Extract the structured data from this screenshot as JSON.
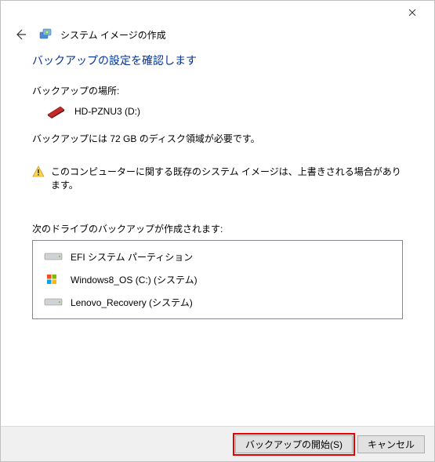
{
  "window": {
    "title": "システム イメージの作成"
  },
  "page": {
    "heading": "バックアップの設定を確認します",
    "location_label": "バックアップの場所:",
    "location_name": "HD-PZNU3 (D:)",
    "disk_requirement": "バックアップには 72 GB のディスク領域が必要です。",
    "warning": "このコンピューターに関する既存のシステム イメージは、上書きされる場合があります。",
    "drives_label": "次のドライブのバックアップが作成されます:"
  },
  "drives": [
    {
      "icon": "hdd",
      "name": "EFI システム パーティション"
    },
    {
      "icon": "win",
      "name": "Windows8_OS (C:) (システム)"
    },
    {
      "icon": "hdd",
      "name": "Lenovo_Recovery (システム)"
    }
  ],
  "buttons": {
    "start": "バックアップの開始(S)",
    "cancel": "キャンセル"
  }
}
